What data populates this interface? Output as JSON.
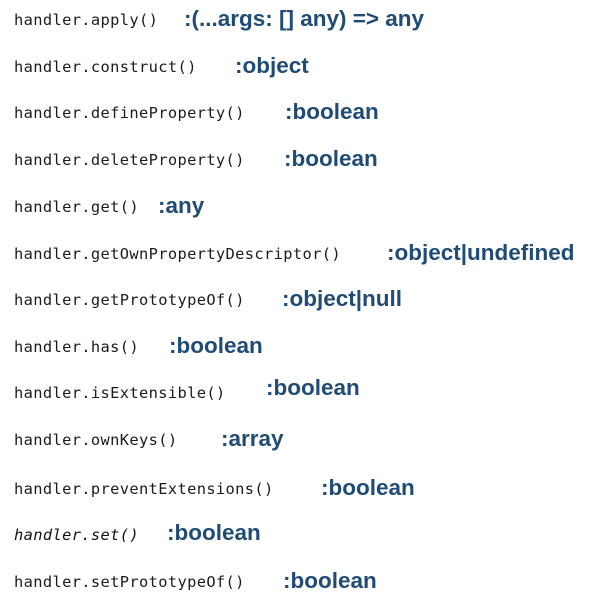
{
  "entries": [
    {
      "method": "handler.apply()",
      "type": ":(...args: [] any) => any"
    },
    {
      "method": "handler.construct()",
      "type": ":object"
    },
    {
      "method": "handler.defineProperty()",
      "type": ":boolean"
    },
    {
      "method": "handler.deleteProperty()",
      "type": ":boolean"
    },
    {
      "method": "handler.get()",
      "type": ":any"
    },
    {
      "method": "handler.getOwnPropertyDescriptor()",
      "type": ":object|undefined"
    },
    {
      "method": "handler.getPrototypeOf()",
      "type": ":object|null"
    },
    {
      "method": "handler.has()",
      "type": ":boolean"
    },
    {
      "method": "handler.isExtensible()",
      "type": ":boolean"
    },
    {
      "method": "handler.ownKeys()",
      "type": ":array"
    },
    {
      "method": "handler.preventExtensions()",
      "type": ":boolean"
    },
    {
      "method": "handler.set()",
      "type": ":boolean"
    },
    {
      "method": "handler.setPrototypeOf()",
      "type": ":boolean"
    }
  ],
  "colors": {
    "method_text": "#1b1b1b",
    "return_type": "#1f4b74",
    "background": "#ffffff"
  }
}
